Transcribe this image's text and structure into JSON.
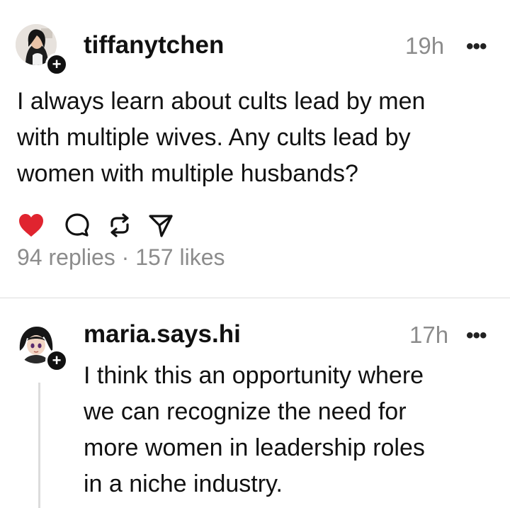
{
  "post": {
    "username": "tiffanytchen",
    "time": "19h",
    "more": "•••",
    "follow_symbol": "+",
    "text": "I always learn about cults lead by men\nwith multiple wives. Any cults lead by\nwomen with multiple husbands?",
    "liked": true,
    "actions": [
      "heart-icon",
      "comment-icon",
      "repost-icon",
      "share-icon"
    ],
    "replies_label": "94 replies",
    "separator": " · ",
    "likes_label": "157 likes"
  },
  "reply": {
    "username": "maria.says.hi",
    "time": "17h",
    "more": "•••",
    "follow_symbol": "+",
    "text": "I think this an opportunity where\nwe can recognize the need for\nmore women in leadership roles\nin a niche industry."
  },
  "colors": {
    "like_red": "#e0242f",
    "muted_text": "#8c8c8c",
    "primary_text": "#111111",
    "divider": "#dcdcdc"
  }
}
